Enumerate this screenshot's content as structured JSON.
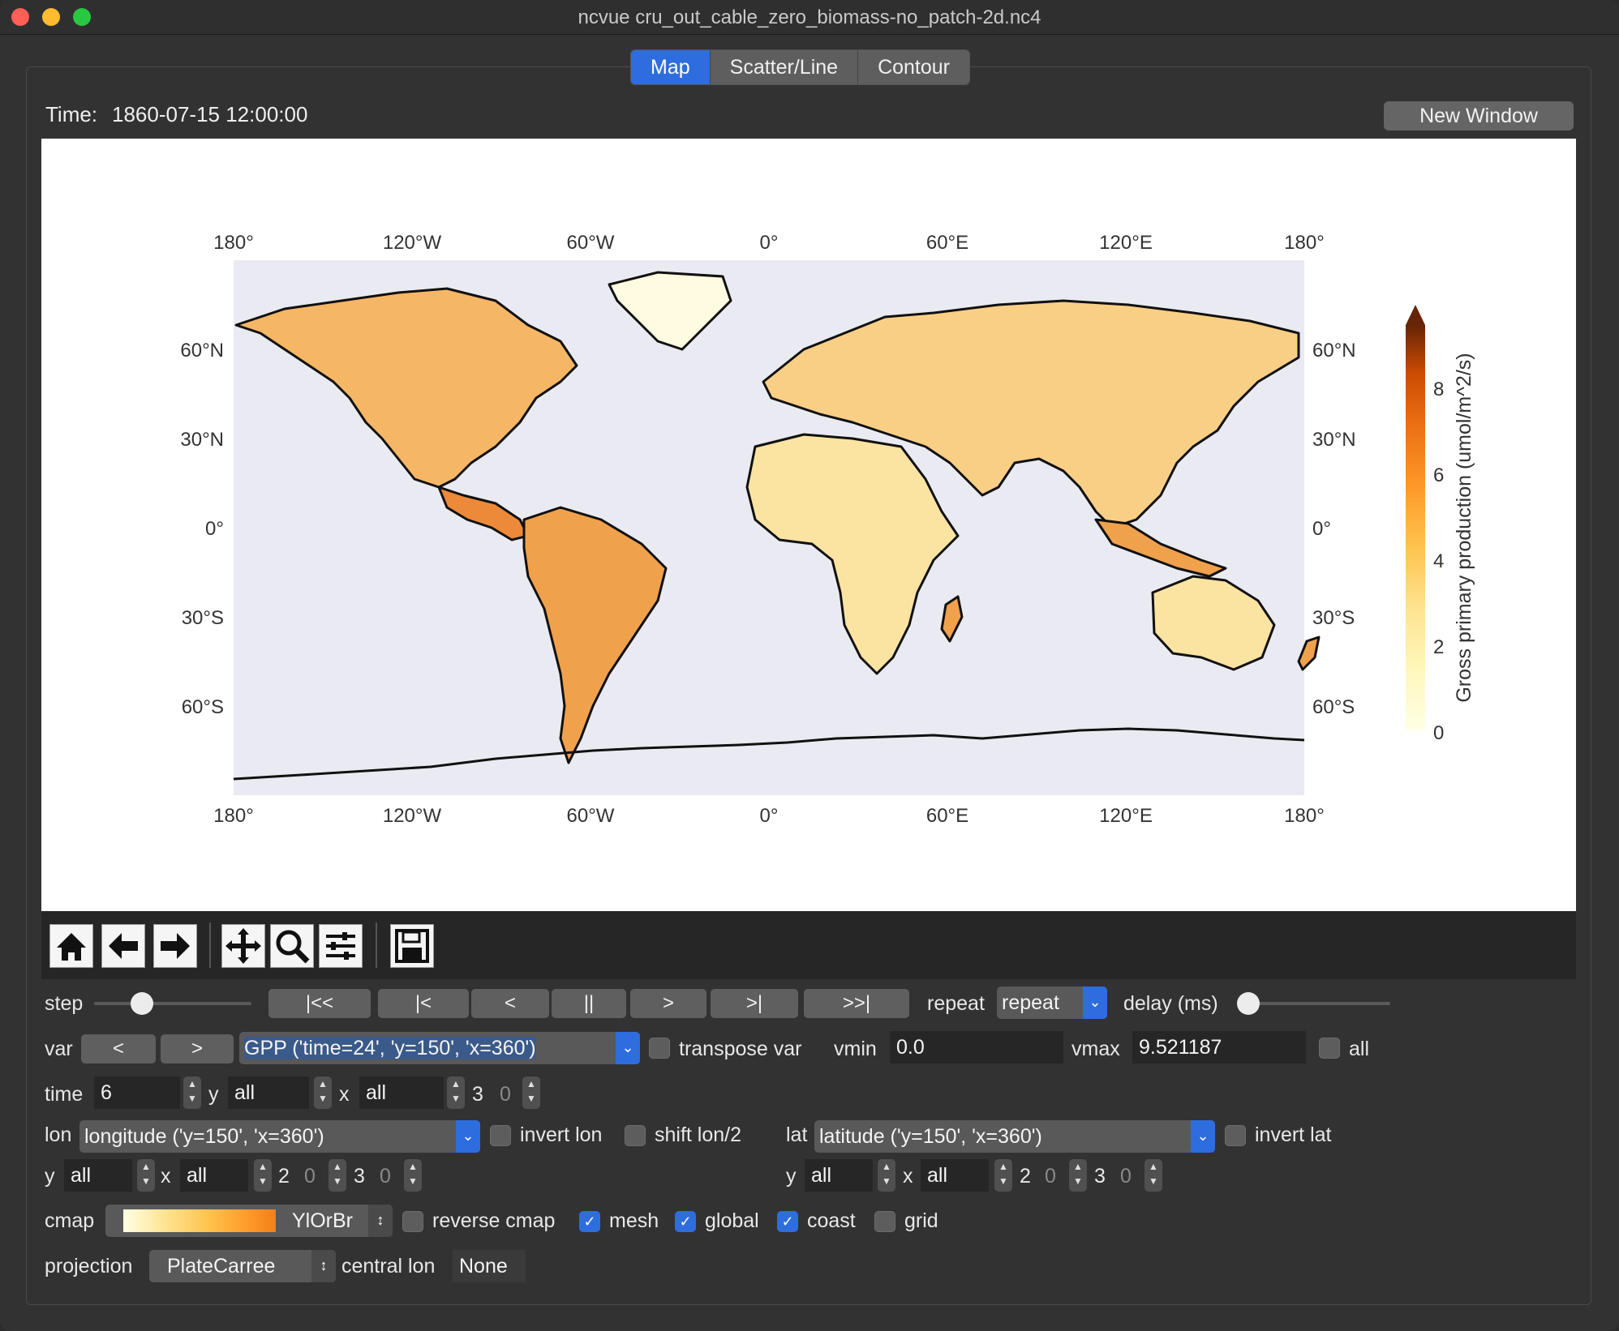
{
  "window": {
    "title": "ncvue cru_out_cable_zero_biomass-no_patch-2d.nc4"
  },
  "tabs": [
    {
      "label": "Map"
    },
    {
      "label": "Scatter/Line"
    },
    {
      "label": "Contour"
    }
  ],
  "time": {
    "label": "Time:",
    "value": "1860-07-15 12:00:00"
  },
  "new_window": "New Window",
  "map": {
    "top_ticks": [
      "180°",
      "120°W",
      "60°W",
      "0°",
      "60°E",
      "120°E",
      "180°"
    ],
    "bottom_ticks": [
      "180°",
      "120°W",
      "60°W",
      "0°",
      "60°E",
      "120°E",
      "180°"
    ],
    "left_ticks": [
      "60°N",
      "30°N",
      "0°",
      "30°S",
      "60°S"
    ],
    "right_ticks": [
      "60°N",
      "30°N",
      "0°",
      "30°S",
      "60°S"
    ],
    "colorbar_label": "Gross primary production (umol/m^2/s)",
    "colorbar_ticks": [
      "0",
      "2",
      "4",
      "6",
      "8"
    ],
    "ocean_color": "#eaeaf2",
    "colormap": [
      "#ffffe5",
      "#fee391",
      "#fec44f",
      "#fe9929",
      "#ec7014",
      "#cc4c02",
      "#8c2d04",
      "#662506"
    ]
  },
  "toolbar_icons": [
    "home-icon",
    "back-arrow-icon",
    "forward-arrow-icon",
    "pan-icon",
    "zoom-icon",
    "configure-icon",
    "save-icon"
  ],
  "controls": {
    "step_label": "step",
    "nav": [
      "|<<",
      "|<",
      "<",
      "||",
      ">",
      ">|",
      ">>|"
    ],
    "repeat_label": "repeat",
    "repeat_value": "repeat",
    "delay_label": "delay (ms)",
    "var_label": "var",
    "var_prev": "<",
    "var_next": ">",
    "var_value": "GPP ('time=24', 'y=150', 'x=360')",
    "transpose_label": "transpose var",
    "vmin_label": "vmin",
    "vmin_value": "0.0",
    "vmax_label": "vmax",
    "vmax_value": "9.521187",
    "all_label": "all",
    "time_label": "time",
    "time_value": "6",
    "y_label": "y",
    "y_value": "all",
    "x_label": "x",
    "x_value": "all",
    "dim3": "3",
    "dim0": "0",
    "lon_label": "lon",
    "lon_value": "longitude ('y=150', 'x=360')",
    "invert_lon": "invert lon",
    "shift_lon": "shift lon/2",
    "lat_label": "lat",
    "lat_value": "latitude ('y=150', 'x=360')",
    "invert_lat": "invert lat",
    "lon_y_label": "y",
    "lon_y_value": "all",
    "lon_x_label": "x",
    "lon_x_value": "all",
    "lon_d2": "2",
    "lon_d2v": "0",
    "lon_d3": "3",
    "lon_d3v": "0",
    "lat_y_label": "y",
    "lat_y_value": "all",
    "lat_x_label": "x",
    "lat_x_value": "all",
    "lat_d2": "2",
    "lat_d2v": "0",
    "lat_d3": "3",
    "lat_d3v": "0",
    "cmap_label": "cmap",
    "cmap_value": "YlOrBr",
    "reverse_cmap": "reverse cmap",
    "mesh": "mesh",
    "global": "global",
    "coast": "coast",
    "grid": "grid",
    "projection_label": "projection",
    "projection_value": "PlateCarree",
    "central_lon_label": "central lon",
    "central_lon_value": "None"
  }
}
